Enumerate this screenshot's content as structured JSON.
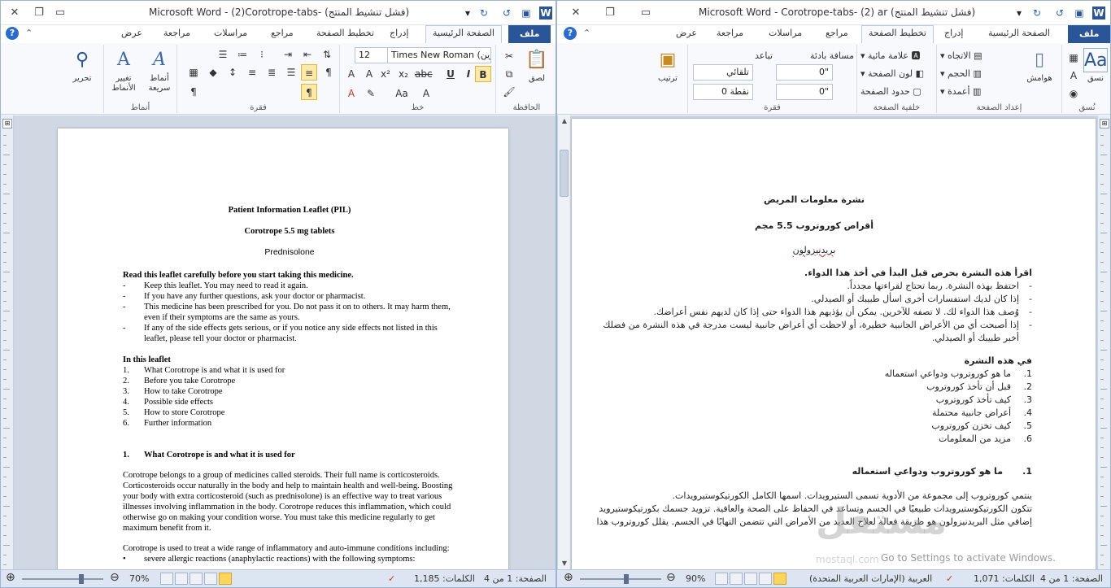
{
  "left": {
    "title": "Microsoft Word  -  (2)Corotrope-tabs-  (فشل تنشيط المنتج)",
    "tabs": {
      "file": "ملف",
      "home": "الصفحة الرئيسية",
      "insert": "إدراج",
      "layout": "تخطيط الصفحة",
      "refs": "مراجع",
      "mail": "مراسلات",
      "review": "مراجعة",
      "view": "عرض"
    },
    "ribbon": {
      "clipboard": "الحافظة",
      "paste": "لصق",
      "font": "خط",
      "font_name": "Times New Roman (عناوين",
      "font_size": "12",
      "paragraph": "فقرة",
      "styles": "أنماط",
      "quick_styles": "أنماط سريعة",
      "change_styles": "تغيير الأنماط",
      "editing": "تحرير"
    },
    "doc": {
      "title": "Patient Information Leaflet (PIL)",
      "product": "Corotrope 5.5 mg tablets",
      "ingredient": "Prednisolone",
      "read_heading": "Read this leaflet carefully before you start taking this medicine.",
      "bullets": [
        "Keep this leaflet.  You may need to read it again.",
        "If you have any further questions, ask your doctor or pharmacist.",
        "This medicine has been prescribed for you.  Do not pass it on to others. It may harm them, even if their symptoms are the same as yours.",
        "If any of the side effects gets serious, or if you notice any side effects not listed in this leaflet, please tell your doctor or pharmacist."
      ],
      "toc_heading": "In this leaflet",
      "toc": [
        {
          "n": "1.",
          "t": "What Corotrope is and what it is used for"
        },
        {
          "n": "2.",
          "t": "Before you take Corotrope"
        },
        {
          "n": "3.",
          "t": "How to take Corotrope"
        },
        {
          "n": "4.",
          "t": "Possible side effects"
        },
        {
          "n": "5.",
          "t": "How to  store Corotrope"
        },
        {
          "n": "6.",
          "t": "Further information"
        }
      ],
      "section1_n": "1.",
      "section1_title": "What Corotrope is and what it is used for",
      "para1": "Corotrope belongs to a group of medicines called steroids. Their full name is corticosteroids. Corticosteroids occur naturally in the body and help to maintain health and well-being. Boosting your body with extra corticosteroid (such as prednisolone) is an effective way to treat various illnesses involving inflammation in the body. Corotrope reduces this inflammation, which could otherwise go on making your condition worse. You must take this medicine regularly to get  maximum benefit from it.",
      "para2": "Corotrope is used to treat a wide range of inflammatory and auto-immune conditions including:",
      "bullet2": "severe allergic reactions (anaphylactic reactions) with the following symptoms:"
    },
    "status": {
      "page": "الصفحة: 1 من 4",
      "words": "الكلمات: 1,185",
      "zoom": "70%",
      "lang": ""
    }
  },
  "right": {
    "title": "Microsoft Word  -  Corotrope-tabs- (2) ar  (فشل تنشيط المنتج)",
    "tabs": {
      "file": "ملف",
      "home": "الصفحة الرئيسية",
      "insert": "إدراج",
      "layout": "تخطيط الصفحة",
      "refs": "مراجع",
      "mail": "مراسلات",
      "review": "مراجعة",
      "view": "عرض"
    },
    "ribbon": {
      "themes": "نسق",
      "themes_group": "نُسق",
      "margins": "هوامش",
      "orientation": "الاتجاه",
      "size": "الحجم",
      "columns": "أعمدة",
      "page_setup": "إعداد الصفحة",
      "watermark": "علامة مائية",
      "page_color": "لون الصفحة",
      "page_borders": "حدود الصفحة",
      "page_bg": "خلفية الصفحة",
      "indent": "مسافة بادئة",
      "spacing": "تباعد",
      "indent_left": "0\"",
      "indent_right": "0\"",
      "spacing_before": "تلقائي",
      "spacing_after": "0 نقطة",
      "paragraph": "فقرة",
      "arrange": "ترتيب"
    },
    "doc": {
      "title": "نشرة معلومات المريض",
      "product": "أقراص كوروتروب 5.5 مجم",
      "ingredient": "بريدنيزولون",
      "read_heading": "اقرأ هذه النشرة بحرص قبل البدأ في أخذ هذا الدواء.",
      "bullets": [
        "احتفظ بهذه النشرة. ربما تحتاج لقراءتها مجدداً.",
        "إذا كان لديك استفسارات أخرى اسأل طبيبك أو الصيدلي.",
        "وُصف هذا الدواء لك.  لا تصفه للآخرين. يمكن أن يؤذيهم هذا الدواء حتى إذا كان لديهم نفس أعراضك.",
        "إذا أصبحت أي من الأعراض الجانبية خطيرة، أو لاحظت أي أعراض جانبية ليست مدرجة في هذه النشرة من فضلك أخبر طبيبك أو الصيدلي."
      ],
      "toc_heading": "في هذه النشرة",
      "toc": [
        {
          "n": "1.",
          "t": "ما هو كوروتروب ودواعي استعماله"
        },
        {
          "n": "2.",
          "t": "قبل أن تأخذ كوروتروب"
        },
        {
          "n": "3.",
          "t": "كيف تأخذ كوروتروب"
        },
        {
          "n": "4.",
          "t": "أعراض جانبية محتملة"
        },
        {
          "n": "5.",
          "t": "كيف تخزن كوروتروب"
        },
        {
          "n": "6.",
          "t": "مزيد من المعلومات"
        }
      ],
      "section1_n": "1.",
      "section1_title": "ما هو كوروتروب ودواعي استعماله",
      "para1a": "ينتمي كوروتروب إلى مجموعة من الأدوية تسمى الستيرويدات. اسمها الكامل الكورتيكوستيرويدات.",
      "para1b": "تتكون الكورتيكوستيرويدات طبيعيًا في الجسم وتساعد في الحفاظ على الصحة والعافية. تزويد جسمك بكورتيكوستيرويد",
      "para1c": "إضافي مثل البريدنيزولون  هو طريقة فعالة لعلاج العديد من الأمراض التي تتضمن التهابًا في الجسم. يقلل كوروتروب هذا"
    },
    "watermark_brand": "مستقل",
    "watermark_sub": "mostaql.com",
    "activate": "Go to Settings to activate Windows.",
    "status": {
      "page": "الصفحة: 1 من 4",
      "words": "الكلمات: 1,071",
      "lang": "العربية (الإمارات العربية المتحدة)",
      "zoom": "90%"
    }
  }
}
